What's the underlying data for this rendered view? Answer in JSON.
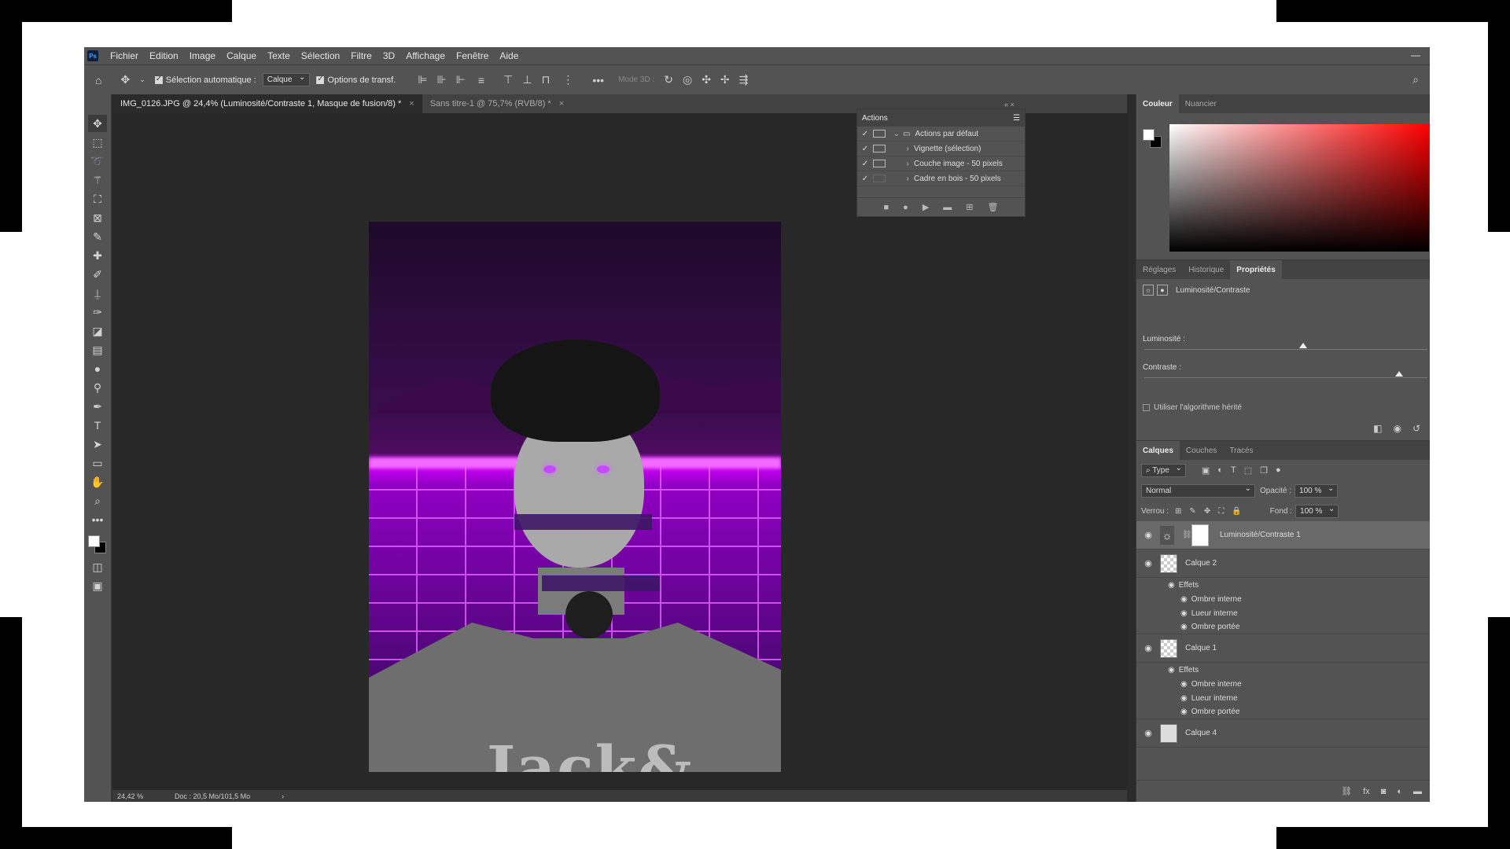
{
  "menubar": {
    "app_icon": "Ps",
    "items": [
      "Fichier",
      "Edition",
      "Image",
      "Calque",
      "Texte",
      "Sélection",
      "Filtre",
      "3D",
      "Affichage",
      "Fenêtre",
      "Aide"
    ],
    "minimize": "—"
  },
  "options": {
    "auto_select_label": "Sélection automatique :",
    "auto_select_value": "Calque",
    "transform_label": "Options de transf.",
    "mode3d_label": "Mode 3D :"
  },
  "tabs": [
    {
      "label": "IMG_0126.JPG @ 24,4% (Luminosité/Contraste 1, Masque de fusion/8) *",
      "close": "×"
    },
    {
      "label": "Sans titre-1 @ 75,7% (RVB/8) *",
      "close": "×"
    }
  ],
  "actions_panel": {
    "title": "Actions",
    "rows": [
      {
        "label": "Actions par défaut",
        "checked": "✓"
      },
      {
        "label": "Vignette (sélection)",
        "checked": "✓"
      },
      {
        "label": "Couche image - 50 pixels",
        "checked": "✓"
      },
      {
        "label": "Cadre en bois - 50 pixels",
        "checked": "✓"
      }
    ]
  },
  "color_panel": {
    "tabs": [
      "Couleur",
      "Nuancier"
    ],
    "hue_color": "#ff0000"
  },
  "properties_panel": {
    "tabs": [
      "Réglages",
      "Historique",
      "Propriétés"
    ],
    "title": "Luminosité/Contraste",
    "brightness_label": "Luminosité :",
    "contrast_label": "Contraste :",
    "brightness_level": 0.56,
    "contrast_level": 0.9,
    "legacy_label": "Utiliser l'algorithme hérité"
  },
  "layers_panel": {
    "tabs": [
      "Calques",
      "Couches",
      "Tracés"
    ],
    "filter_value": "Type",
    "blend_mode": "Normal",
    "opacity_label": "Opacité :",
    "opacity_value": "100 %",
    "lock_label": "Verrou :",
    "fill_label": "Fond :",
    "fill_value": "100 %",
    "layers": [
      {
        "name": "Luminosité/Contraste 1"
      },
      {
        "name": "Calque 2",
        "effects_label": "Effets",
        "effects": [
          "Ombre interne",
          "Lueur interne",
          "Ombre portée"
        ]
      },
      {
        "name": "Calque 1",
        "effects_label": "Effets",
        "effects": [
          "Ombre interne",
          "Lueur interne",
          "Ombre portée"
        ]
      },
      {
        "name": "Calque 4"
      }
    ]
  },
  "status": {
    "zoom": "24,42 %",
    "doc": "Doc : 20,5 Mo/101,5 Mo"
  },
  "canvas_image": {
    "shirt_text": "Jack&"
  }
}
